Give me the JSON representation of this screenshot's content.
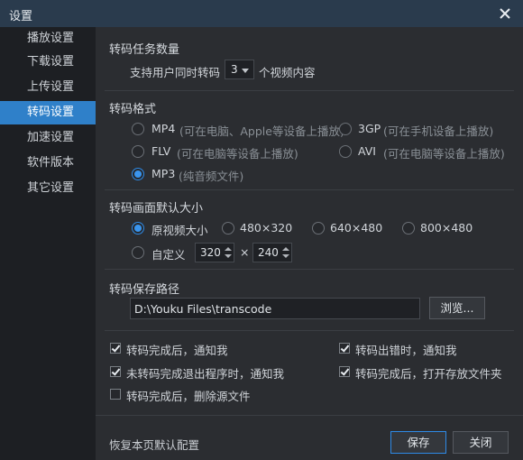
{
  "window": {
    "title": "设置"
  },
  "sidebar": {
    "items": [
      {
        "label": "播放设置",
        "active": false
      },
      {
        "label": "下载设置",
        "active": false
      },
      {
        "label": "上传设置",
        "active": false
      },
      {
        "label": "转码设置",
        "active": true
      },
      {
        "label": "加速设置",
        "active": false
      },
      {
        "label": "软件版本",
        "active": false
      },
      {
        "label": "其它设置",
        "active": false
      }
    ]
  },
  "task_count": {
    "title": "转码任务数量",
    "prefix": "支持用户同时转码",
    "value": "3",
    "suffix": "个视频内容"
  },
  "format": {
    "title": "转码格式",
    "options": [
      {
        "label": "MP4",
        "desc": "(可在电脑、Apple等设备上播放)",
        "selected": false
      },
      {
        "label": "3GP",
        "desc": "(可在手机设备上播放)",
        "selected": false
      },
      {
        "label": "FLV",
        "desc": "(可在电脑等设备上播放)",
        "selected": false
      },
      {
        "label": "AVI",
        "desc": "(可在电脑等设备上播放)",
        "selected": false
      },
      {
        "label": "MP3",
        "desc": "(纯音频文件)",
        "selected": true
      }
    ]
  },
  "size": {
    "title": "转码画面默认大小",
    "options": [
      {
        "label": "原视频大小",
        "selected": true
      },
      {
        "label": "480×320",
        "selected": false
      },
      {
        "label": "640×480",
        "selected": false
      },
      {
        "label": "800×480",
        "selected": false
      },
      {
        "label": "自定义",
        "selected": false
      }
    ],
    "custom_width": "320",
    "times": "×",
    "custom_height": "240"
  },
  "save_path": {
    "title": "转码保存路径",
    "value": "D:\\Youku Files\\transcode",
    "browse_label": "浏览..."
  },
  "notifications": [
    {
      "label": "转码完成后，通知我",
      "checked": true
    },
    {
      "label": "转码出错时，通知我",
      "checked": true
    },
    {
      "label": "未转码完成退出程序时，通知我",
      "checked": true
    },
    {
      "label": "转码完成后，打开存放文件夹",
      "checked": true
    },
    {
      "label": "转码完成后，删除源文件",
      "checked": false
    }
  ],
  "footer": {
    "restore_label": "恢复本页默认配置",
    "save_label": "保存",
    "close_label": "关闭"
  },
  "colors": {
    "accent": "#2f80c9",
    "titlebar": "#2a3b4d",
    "panel": "#2b2d31",
    "sidebar": "#1d1f23"
  }
}
